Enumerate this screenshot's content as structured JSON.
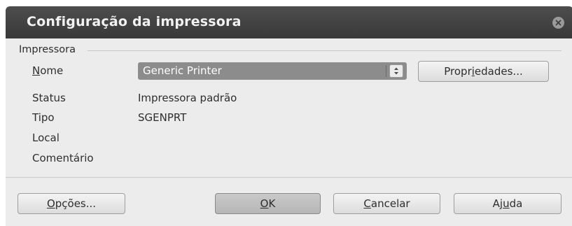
{
  "window": {
    "title": "Configuração da impressora"
  },
  "printer_group": {
    "label": "Impressora",
    "name": {
      "label_mnemonic": "N",
      "label_rest": "ome",
      "selected": "Generic Printer"
    },
    "properties_button": {
      "pre": "Propr",
      "mnemonic": "i",
      "post": "edades..."
    },
    "fields": [
      {
        "label": "Status",
        "value": "Impressora padrão"
      },
      {
        "label": "Tipo",
        "value": "SGENPRT"
      },
      {
        "label": "Local",
        "value": ""
      },
      {
        "label": "Comentário",
        "value": ""
      }
    ]
  },
  "buttons": {
    "options": {
      "mnemonic": "O",
      "rest": "pções..."
    },
    "ok": {
      "mnemonic": "O",
      "rest": "K"
    },
    "cancel": {
      "mnemonic": "C",
      "rest": "ancelar"
    },
    "help": {
      "pre": "Aj",
      "mnemonic": "u",
      "post": "da"
    }
  },
  "icons": {
    "close": "close-icon",
    "combo_arrows": "up-down-arrows-icon"
  }
}
